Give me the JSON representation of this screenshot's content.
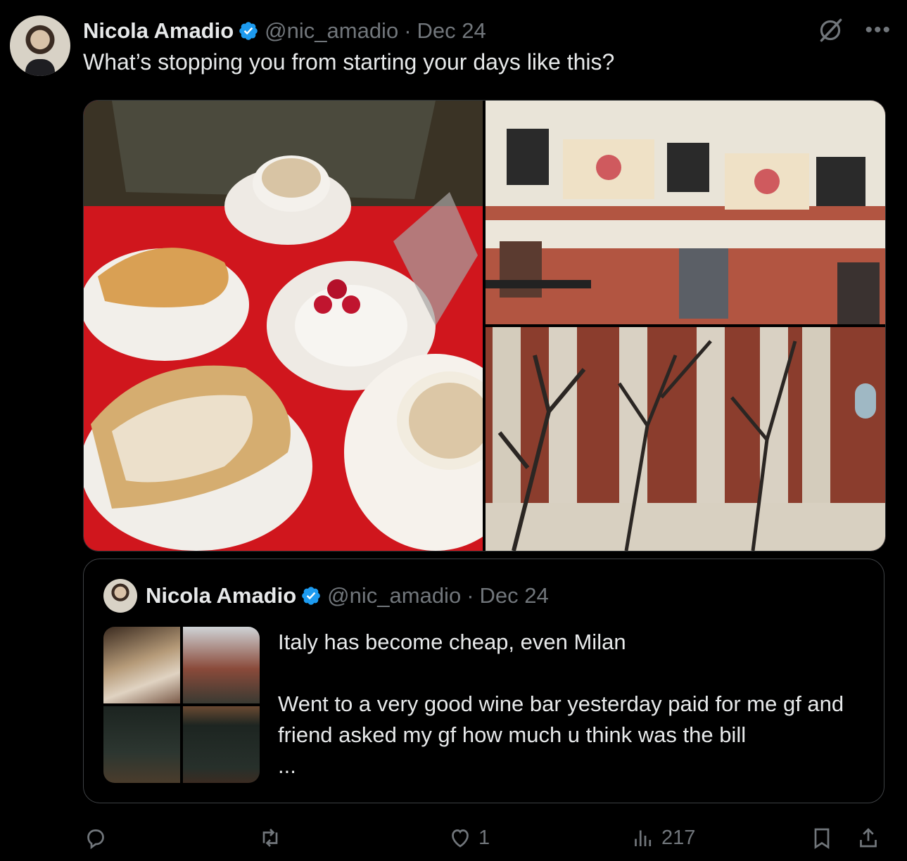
{
  "tweet": {
    "author_name": "Nicola Amadio",
    "handle": "@nic_amadio",
    "separator": "·",
    "date": "Dec 24",
    "text": "What’s stopping you from starting your days like this?"
  },
  "quoted_tweet": {
    "author_name": "Nicola Amadio",
    "handle": "@nic_amadio",
    "separator": "·",
    "date": "Dec 24",
    "line1": "Italy has become cheap, even Milan",
    "line2": "Went to a very good wine bar yesterday paid for me gf and friend asked my gf how much u think was the bill",
    "line3": "..."
  },
  "actions": {
    "reply_count": "",
    "retweet_count": "",
    "like_count": "1",
    "views_count": "217"
  },
  "icons": {
    "verified": "verified-badge-icon",
    "grok": "grok-icon",
    "more": "more-icon",
    "reply": "reply-icon",
    "retweet": "retweet-icon",
    "like": "heart-icon",
    "views": "views-icon",
    "bookmark": "bookmark-icon",
    "share": "share-icon"
  },
  "colors": {
    "background": "#000000",
    "text": "#e7e9ea",
    "muted": "#71767b",
    "verified": "#1d9bf0",
    "border": "#2f3336"
  }
}
